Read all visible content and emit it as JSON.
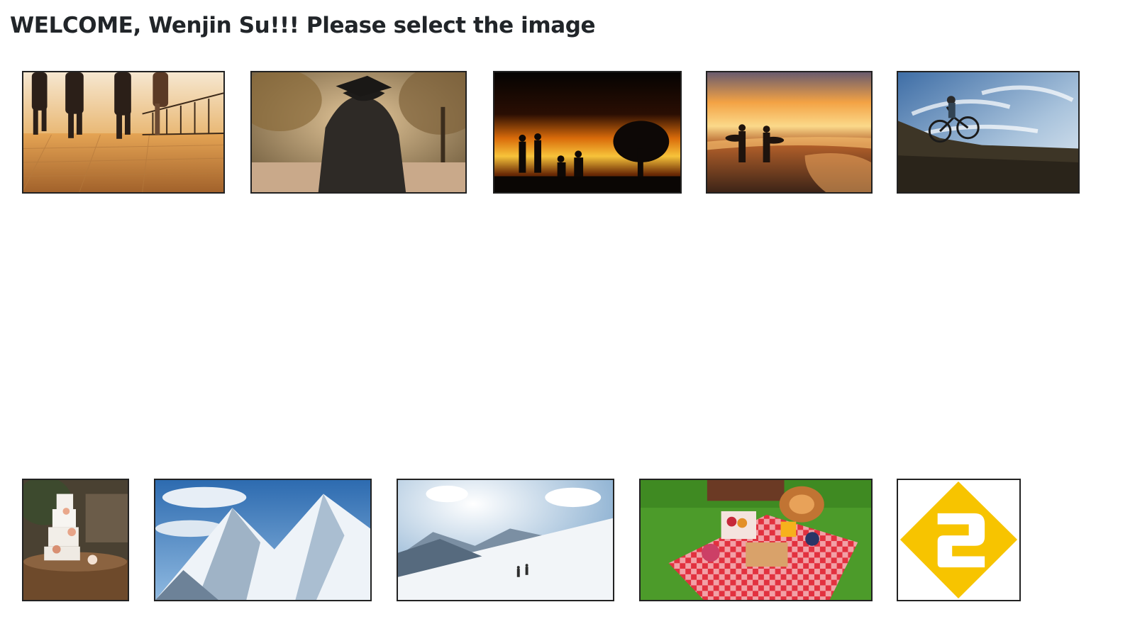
{
  "page": {
    "welcome_text": "WELCOME, Wenjin Su!!! Please select the image"
  },
  "images": [
    {
      "subject": "runners on brick boardwalk at sunset"
    },
    {
      "subject": "graduate in cap and gown under trees"
    },
    {
      "subject": "silhouettes of people at fiery sunset"
    },
    {
      "subject": "surfers walking on beach at sunset"
    },
    {
      "subject": "mountain biker on rocky hill under cloudy sky"
    },
    {
      "subject": "tiered wedding cake on wooden table"
    },
    {
      "subject": "snowy mountain peaks under blue sky"
    },
    {
      "subject": "skiers on snowy slope"
    },
    {
      "subject": "picnic on red checkered blanket on grass"
    },
    {
      "subject": "yellow diamond logo with white number 2"
    }
  ],
  "colors": {
    "text": "#212529",
    "border": "#222222",
    "logo_yellow": "#f7c400"
  }
}
